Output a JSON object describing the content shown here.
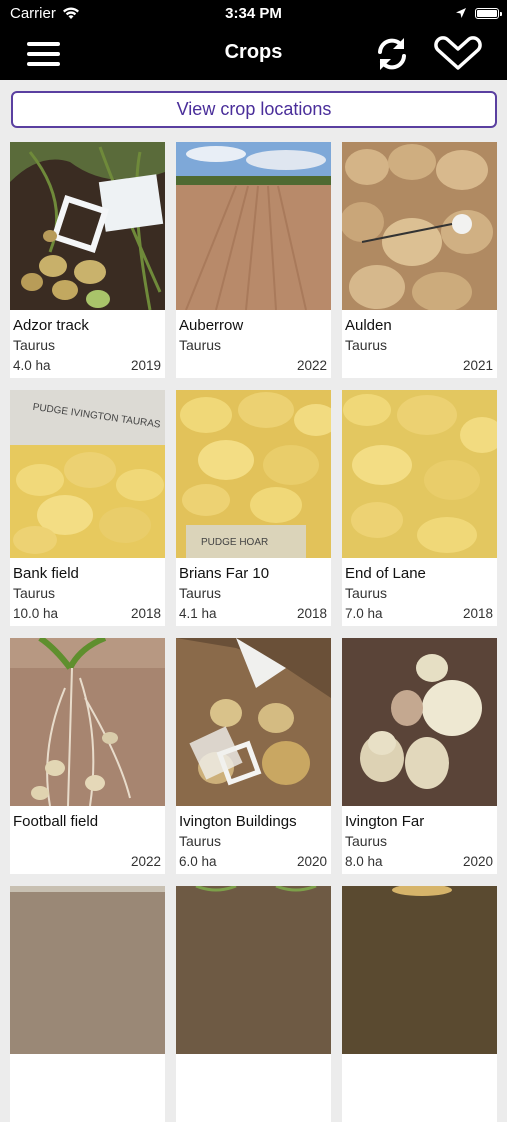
{
  "status": {
    "carrier": "Carrier",
    "time": "3:34 PM"
  },
  "nav": {
    "title": "Crops",
    "menu_icon": "hamburger-menu-icon",
    "refresh_icon": "refresh-icon",
    "filter_icon": "chevron-down-icon"
  },
  "locations_button": "View crop locations",
  "colors": {
    "bar": "#000000",
    "accent": "#4a2e9a",
    "background": "#ececec"
  },
  "crops": [
    {
      "name": "Adzor track",
      "variety": "Taurus",
      "area": "4.0 ha",
      "year": "2019"
    },
    {
      "name": "Auberrow",
      "variety": "Taurus",
      "area": "",
      "year": "2022"
    },
    {
      "name": "Aulden",
      "variety": "Taurus",
      "area": "",
      "year": "2021"
    },
    {
      "name": "Bank field",
      "variety": "Taurus",
      "area": "10.0 ha",
      "year": "2018"
    },
    {
      "name": "Brians Far 10",
      "variety": "Taurus",
      "area": "4.1 ha",
      "year": "2018"
    },
    {
      "name": "End of Lane",
      "variety": "Taurus",
      "area": "7.0 ha",
      "year": "2018"
    },
    {
      "name": "Football field",
      "variety": "",
      "area": "",
      "year": "2022"
    },
    {
      "name": "Ivington Buildings",
      "variety": "Taurus",
      "area": "6.0 ha",
      "year": "2020"
    },
    {
      "name": "Ivington Far",
      "variety": "Taurus",
      "area": "8.0 ha",
      "year": "2020"
    }
  ],
  "photo_labels": {
    "bank_field_bag": "PUDGE IVINGTON TAURAS",
    "brians_bag": "PUDGE HOAR"
  }
}
